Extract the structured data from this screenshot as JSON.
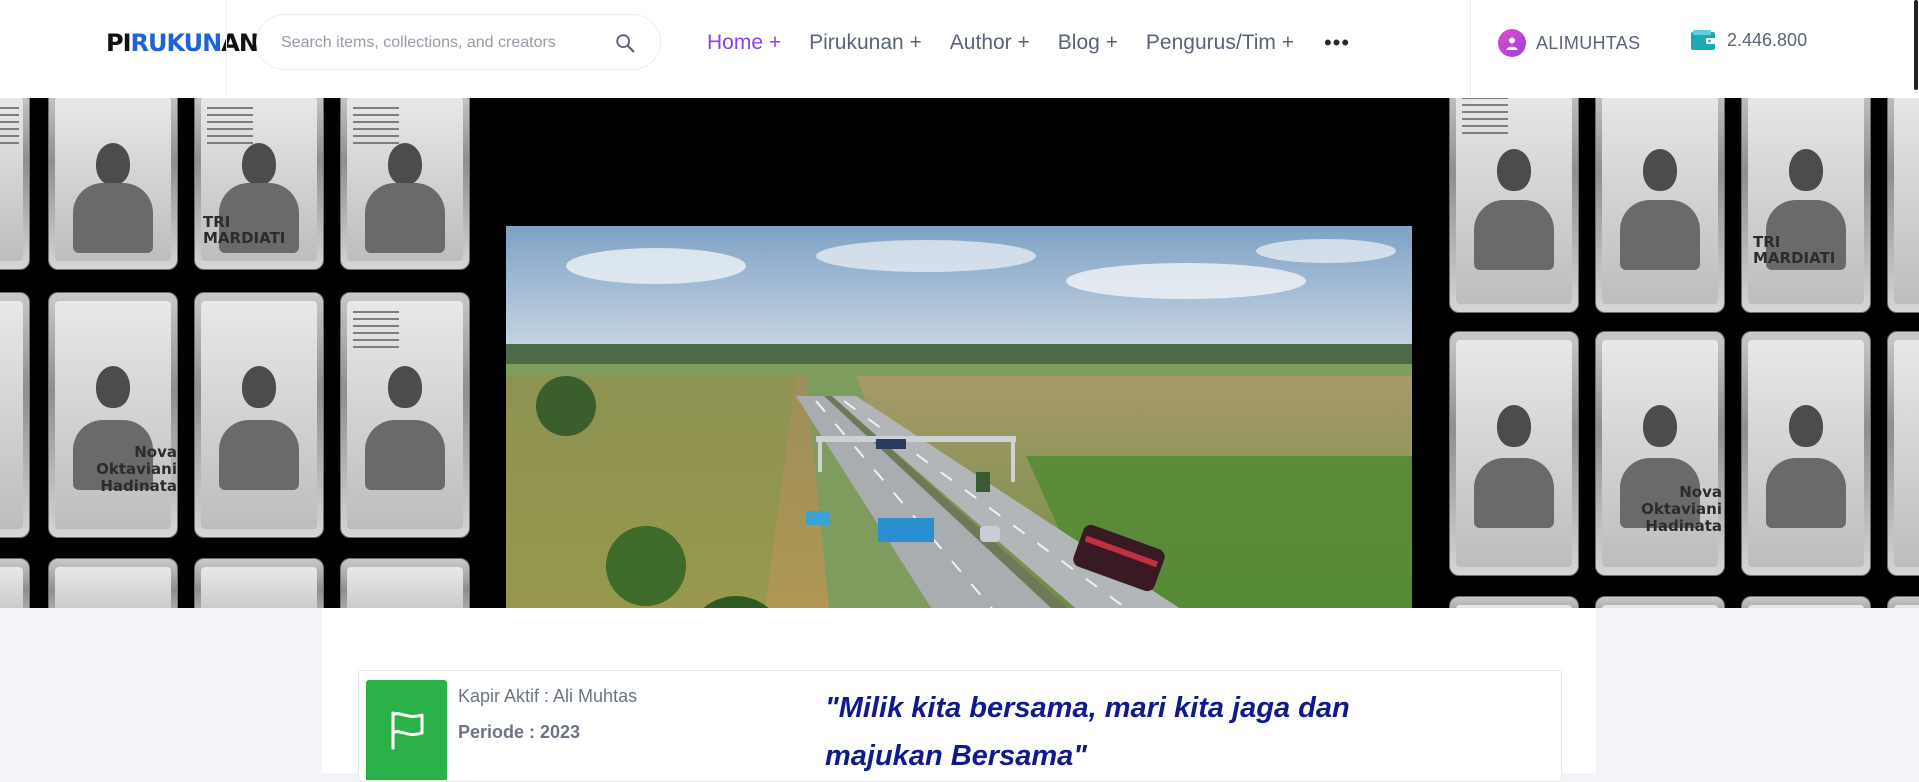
{
  "header": {
    "logo_part1": "PI",
    "logo_part2": "RUKUN",
    "logo_part3": "AN",
    "search_placeholder": "Search items, collections, and creators",
    "nav": [
      {
        "label": "Home +",
        "active": true
      },
      {
        "label": "Pirukunan +",
        "active": false
      },
      {
        "label": "Author +",
        "active": false
      },
      {
        "label": "Blog +",
        "active": false
      },
      {
        "label": "Pengurus/Tim +",
        "active": false
      }
    ],
    "more_label": "•••",
    "user_name": "ALIMUHTAS",
    "balance": "2.446.800",
    "icons": {
      "search": "search-icon",
      "avatar": "user-avatar-icon",
      "wallet": "wallet-icon"
    }
  },
  "hero": {
    "poster_names": [
      "TRI MARDIATI",
      "Nova Oktaviani Hadinata"
    ]
  },
  "info": {
    "kapir": "Kapir Aktif : Ali Muhtas",
    "periode": "Periode : 2023",
    "quote": "\"Milik kita bersama, mari kita jaga dan majukan Bersama\"",
    "icon": "flag-icon"
  },
  "colors": {
    "accent": "#8a3ff0",
    "logo_blue": "#1f63d6",
    "flag_green": "#2bb14a",
    "quote_blue": "#0f1a8c"
  }
}
